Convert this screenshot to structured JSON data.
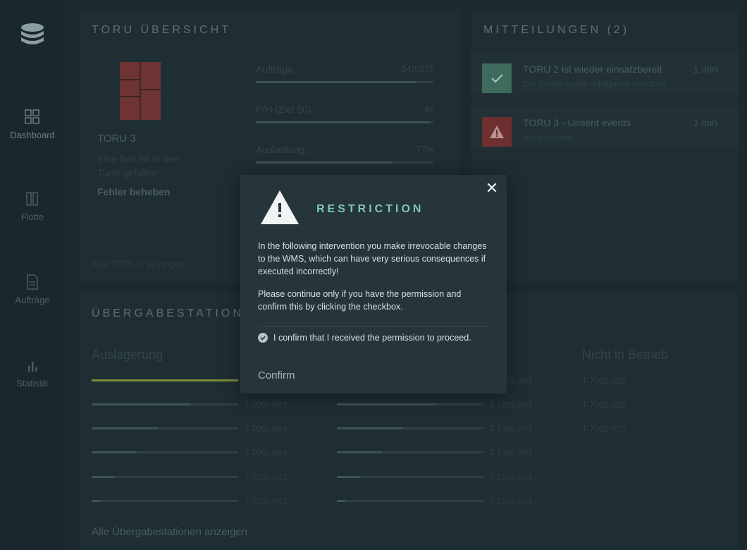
{
  "sidebar": {
    "items": [
      {
        "label": "Dashboard",
        "icon": "dashboard-icon"
      },
      {
        "label": "Flotte",
        "icon": "fleet-icon"
      },
      {
        "label": "Aufträge",
        "icon": "orders-icon"
      },
      {
        "label": "Statistik",
        "icon": "statistics-icon"
      }
    ]
  },
  "overview": {
    "title": "TORU ÜBERSICHT",
    "device_name": "TORU 3",
    "device_status": "Eine Box ist in den Turm gefallen",
    "fix_link": "Fehler beheben",
    "show_all": "Alle TORUs anzeigen",
    "metrics": [
      {
        "label": "Aufträge:",
        "value": "340/375",
        "fill": 0.9
      },
      {
        "label": "P/H (Ziel 50):",
        "value": "49",
        "fill": 0.98
      },
      {
        "label": "Auslastung:",
        "value": "77%",
        "fill": 0.77
      }
    ]
  },
  "notifications": {
    "title": "MITTEILUNGEN (2)",
    "items": [
      {
        "title": "TORU 2 ist wieder einsatzbereit",
        "subtitle": "Der Fehler wurde erfolgreich behoben",
        "time": "1 min",
        "type": "success"
      },
      {
        "title": "TORU 3 - Unsent events",
        "subtitle": "Mark as sent",
        "time": "1 min",
        "type": "warning"
      }
    ]
  },
  "stations": {
    "title": "ÜBERGABESTATIONEN",
    "show_all": "Alle Übergabestationen anzeigen",
    "columns": [
      {
        "title": "Auslagerung",
        "rows": [
          {
            "code": "T-7002-003",
            "fill": 1.0
          },
          {
            "code": "T-7002-003",
            "fill": 0.68
          },
          {
            "code": "T-7002-003",
            "fill": 0.45
          },
          {
            "code": "T-7002-003",
            "fill": 0.31
          },
          {
            "code": "T-7002-003",
            "fill": 0.16
          },
          {
            "code": "T-7002-003",
            "fill": 0.06
          }
        ]
      },
      {
        "title": "",
        "rows": [
          {
            "code": "T-7002-003",
            "fill": 0.0
          },
          {
            "code": "T-7002-003",
            "fill": 0.68
          },
          {
            "code": "T-7002-003",
            "fill": 0.45
          },
          {
            "code": "T-7002-003",
            "fill": 0.31
          },
          {
            "code": "T-7002-003",
            "fill": 0.16
          },
          {
            "code": "T-7002-003",
            "fill": 0.06
          }
        ]
      },
      {
        "title": "Nicht in Betrieb",
        "rows": [
          {
            "code": "T-7002-003"
          },
          {
            "code": "T-7002-003"
          },
          {
            "code": "T-7002-003"
          }
        ]
      }
    ]
  },
  "modal": {
    "title": "RESTRICTION",
    "paragraph1": "In the following intervention you make irrevocable changes to the WMS, which can have very serious consequences if executed incorrectly!",
    "paragraph2": "Please continue only if you have the permission and confirm this by clicking the checkbox.",
    "checkbox_label": "I confirm that I received the permission to proceed.",
    "checkbox_checked": true,
    "confirm_label": "Confirm"
  },
  "colors": {
    "accent": "#7fc6b5",
    "success": "#4f7d6e",
    "warning": "#8a3a3a",
    "progress_highlight": "#7a8a3a"
  }
}
